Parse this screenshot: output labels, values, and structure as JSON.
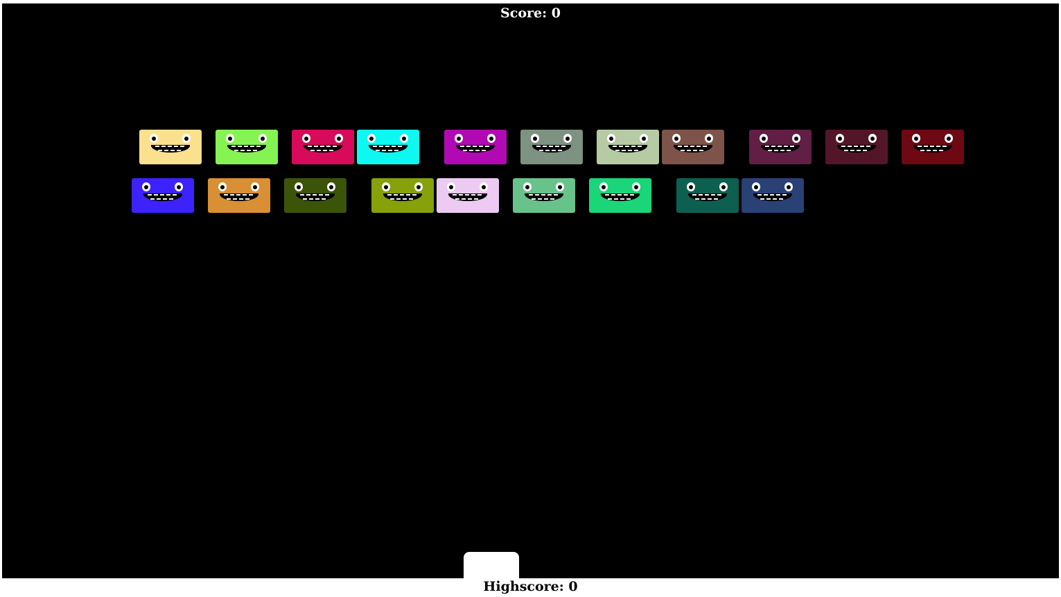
{
  "hud": {
    "score_label": "Score: 0",
    "highscore_label": "Highscore: 0"
  },
  "colors": {
    "background": "#000000",
    "page": "#ffffff",
    "paddle": "#ffffff"
  },
  "monsters": {
    "row1": [
      "#fbe08e",
      "#85f452",
      "#d80a5a",
      "#0cf8f0",
      "#b10ab4",
      "#7d9280",
      "#b6caa4",
      "#7e534a",
      "#611f45",
      "#531628",
      "#6e0813"
    ],
    "row2": [
      "#3d22fb",
      "#d98f33",
      "#3b540a",
      "#86a10a",
      "#eccaf2",
      "#68c38b",
      "#1ad678",
      "#0d6050",
      "#2a4176"
    ]
  }
}
